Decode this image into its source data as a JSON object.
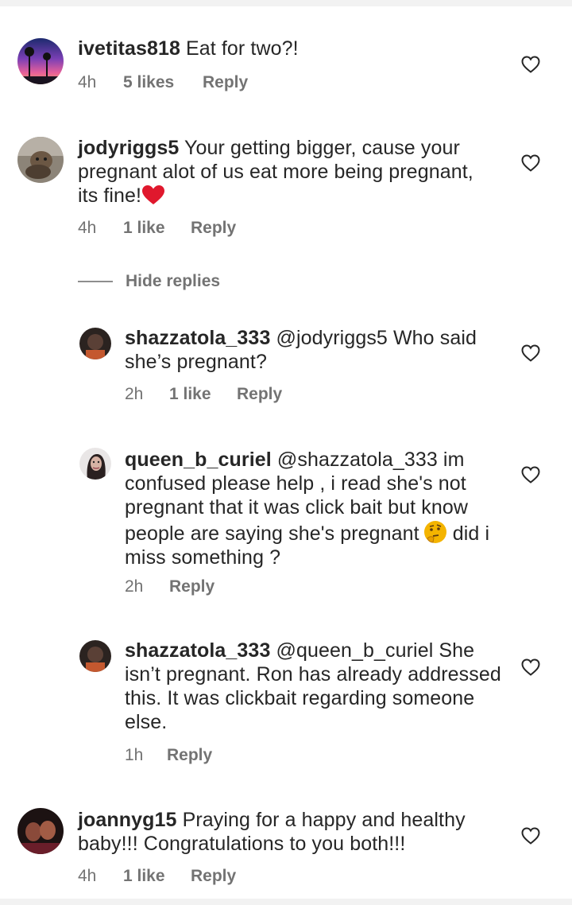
{
  "comments": [
    {
      "username": "ivetitas818",
      "text": "Eat for two?!",
      "time": "4h",
      "likes": "5 likes",
      "reply_label": "Reply"
    },
    {
      "username": "jodyriggs5",
      "text": "Your getting bigger, cause your pregnant alot of us eat more being pregnant, its fine!",
      "emoji": "red-heart",
      "time": "4h",
      "likes": "1 like",
      "reply_label": "Reply",
      "hide_replies_label": "Hide replies",
      "replies": [
        {
          "username": "shazzatola_333",
          "text": "@jodyriggs5 Who said she’s pregnant?",
          "time": "2h",
          "likes": "1 like",
          "reply_label": "Reply"
        },
        {
          "username": "queen_b_curiel",
          "text_before": "@shazzatola_333 im confused please help , i read she's not pregnant that it was click bait but know people are saying she's pregnant",
          "emoji": "thinking-face",
          "text_after": "did i miss something ?",
          "time": "2h",
          "reply_label": "Reply"
        },
        {
          "username": "shazzatola_333",
          "text": "@queen_b_curiel She isn’t pregnant. Ron has already addressed this. It was clickbait regarding  someone else.",
          "time": "1h",
          "reply_label": "Reply"
        }
      ]
    },
    {
      "username": "joannyg15",
      "text": "Praying for a happy and healthy baby!!! Congratulations to you both!!!",
      "time": "4h",
      "likes": "1 like",
      "reply_label": "Reply"
    }
  ],
  "icons": {
    "like": "heart-outline-icon",
    "colors": {
      "text": "#262626",
      "meta": "#737373",
      "heart_emoji": "#e0182d",
      "thinking_emoji": "#f4b400"
    }
  }
}
